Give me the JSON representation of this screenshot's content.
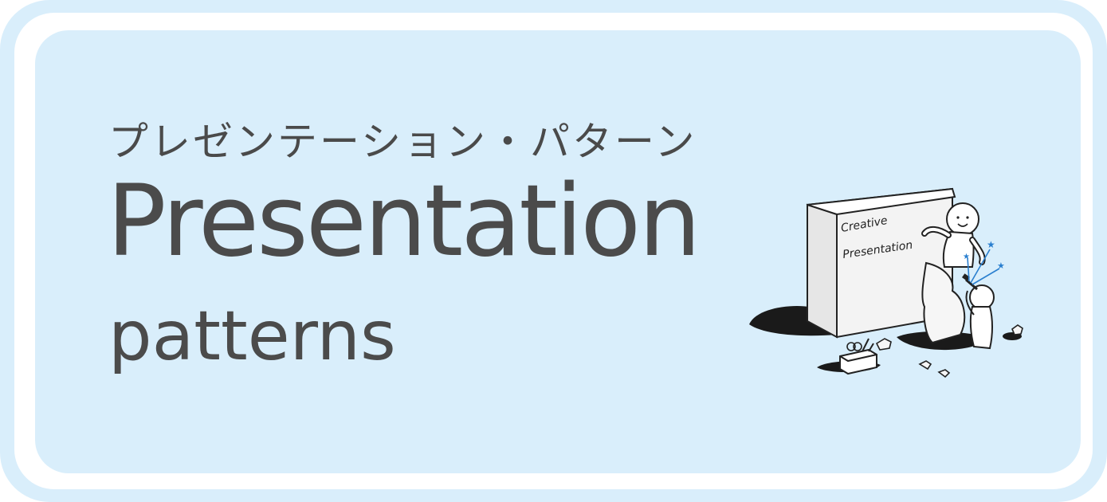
{
  "banner": {
    "kana_title": "プレゼンテーション・パターン",
    "title": "Presentation",
    "subtitle": "patterns"
  },
  "illustration": {
    "board_line1": "Creative",
    "board_line2": "Presentation"
  },
  "colors": {
    "background": "#d9eefb",
    "frame": "#ffffff",
    "text": "#4b4b4b",
    "accent": "#2a7fcf"
  },
  "icons": [
    "sculpting-figures-illustration",
    "toolbox-icon",
    "sparkle-icon"
  ]
}
